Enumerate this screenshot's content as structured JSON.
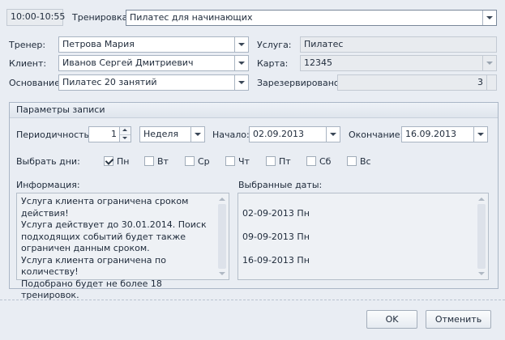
{
  "header": {
    "time_range": "10:00-10:55",
    "training_label": "Тренировка:",
    "training_value": "Пилатес для начинающих"
  },
  "form": {
    "trainer_label": "Тренер:",
    "trainer_value": "Петрова Мария",
    "client_label": "Клиент:",
    "client_value": "Иванов Сергей Дмитриевич",
    "basis_label": "Основание:",
    "basis_value": "Пилатес 20 занятий",
    "service_label": "Услуга:",
    "service_value": "Пилатес",
    "card_label": "Карта:",
    "card_value": "12345",
    "reserved_label": "Зарезервировано:",
    "reserved_value": "3"
  },
  "params": {
    "title": "Параметры записи",
    "periodicity_label": "Периодичность:",
    "periodicity_value": "1",
    "period_unit": "Неделя",
    "start_label": "Начало:",
    "start_value": "02.09.2013",
    "end_label": "Окончание:",
    "end_value": "16.09.2013",
    "days_label": "Выбрать дни:",
    "days": [
      {
        "label": "Пн",
        "checked": true
      },
      {
        "label": "Вт",
        "checked": false
      },
      {
        "label": "Ср",
        "checked": false
      },
      {
        "label": "Чт",
        "checked": false
      },
      {
        "label": "Пт",
        "checked": false
      },
      {
        "label": "Сб",
        "checked": false
      },
      {
        "label": "Вс",
        "checked": false
      }
    ],
    "info_label": "Информация:",
    "info_text": "Услуга клиента ограничена сроком действия!\nУслуга действует до 30.01.2014. Поиск\nподходящих событий будет также\nограничен данным сроком.\nУслуга клиента ограничена по количеству!\nПодобрано будет не более 18 тренировок.",
    "dates_label": "Выбранные даты:",
    "dates": [
      "02-09-2013 Пн",
      "09-09-2013 Пн",
      "16-09-2013 Пн"
    ]
  },
  "footer": {
    "ok_label": "OK",
    "cancel_label": "Отменить"
  },
  "icons": {
    "dropdown": "chevron-down-icon",
    "checkbox_checked": "check-icon",
    "spin": "spin-arrows-icon"
  }
}
